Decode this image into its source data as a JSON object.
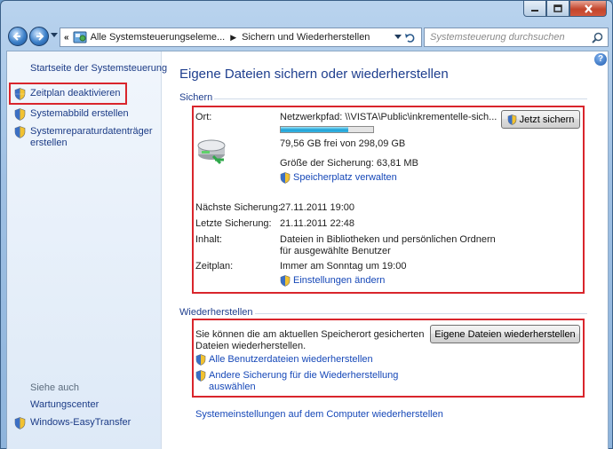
{
  "window": {
    "address": {
      "crumb1": "Alle Systemsteuerungseleme...",
      "crumb2": "Sichern und Wiederherstellen"
    },
    "search_placeholder": "Systemsteuerung durchsuchen"
  },
  "sidebar": {
    "home_link": "Startseite der Systemsteuerung",
    "items": [
      {
        "label": "Zeitplan deaktivieren"
      },
      {
        "label": "Systemabbild erstellen"
      },
      {
        "label": "Systemreparaturdatenträger erstellen"
      }
    ],
    "see_also_heading": "Siehe auch",
    "see_also": [
      {
        "label": "Wartungscenter"
      },
      {
        "label": "Windows-EasyTransfer"
      }
    ]
  },
  "main": {
    "title": "Eigene Dateien sichern oder wiederherstellen",
    "backup": {
      "heading": "Sichern",
      "location_label": "Ort:",
      "location_value": "Netzwerkpfad: \\\\VISTA\\Public\\inkrementelle-sich...",
      "backup_now_button": "Jetzt sichern",
      "free_space": "79,56 GB frei von 298,09 GB",
      "used_fraction": 0.73,
      "backup_size": "Größe der Sicherung: 63,81 MB",
      "manage_space_link": "Speicherplatz verwalten",
      "next_label": "Nächste Sicherung:",
      "next_value": "27.11.2011 19:00",
      "last_label": "Letzte Sicherung:",
      "last_value": "21.11.2011 22:48",
      "content_label": "Inhalt:",
      "content_value_line1": "Dateien in Bibliotheken und persönlichen Ordnern",
      "content_value_line2": "für ausgewählte Benutzer",
      "schedule_label": "Zeitplan:",
      "schedule_value": "Immer am Sonntag um 19:00",
      "change_settings_link": "Einstellungen ändern"
    },
    "restore": {
      "heading": "Wiederherstellen",
      "text_line1": "Sie können die am aktuellen Speicherort gesicherten",
      "text_line2": "Dateien wiederherstellen.",
      "restore_button": "Eigene Dateien wiederherstellen",
      "all_users_link": "Alle Benutzerdateien wiederherstellen",
      "other_backup_link_line1": "Andere Sicherung für die Wiederherstellung",
      "other_backup_link_line2": "auswählen"
    },
    "system_settings_link": "Systemeinstellungen auf dem Computer wiederherstellen"
  },
  "colors": {
    "link": "#1648b8",
    "heading": "#1e3e8e",
    "highlight": "#d9252c",
    "progress_fill": "#1fa3d8"
  }
}
